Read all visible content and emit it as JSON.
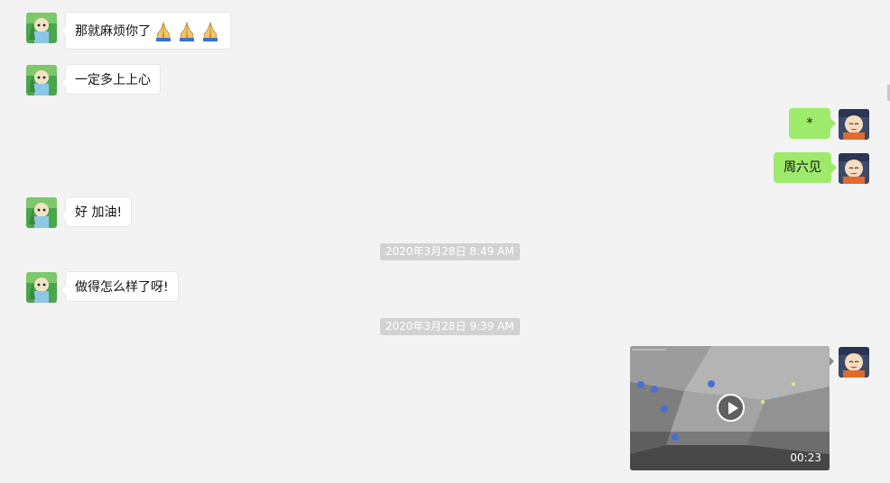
{
  "colors": {
    "background": "#f3f3f3",
    "incoming_bubble": "#ffffff",
    "outgoing_bubble": "#9eea6a",
    "timestamp_bg": "#d2d2d2"
  },
  "messages": [
    {
      "sender": "contact",
      "text": "那就麻烦你了",
      "emoji": [
        "folded-hands",
        "folded-hands",
        "folded-hands"
      ]
    },
    {
      "sender": "contact",
      "text": "一定多上上心"
    },
    {
      "sender": "me",
      "text": "*"
    },
    {
      "sender": "me",
      "text": "周六见"
    },
    {
      "sender": "contact",
      "text": "好 加油!"
    },
    {
      "timestamp": "2020年3月28日 8:49 AM"
    },
    {
      "sender": "contact",
      "text": "做得怎么样了呀!"
    },
    {
      "timestamp": "2020年3月28日 9:39 AM"
    },
    {
      "sender": "me",
      "type": "video",
      "duration": "00:23"
    }
  ]
}
